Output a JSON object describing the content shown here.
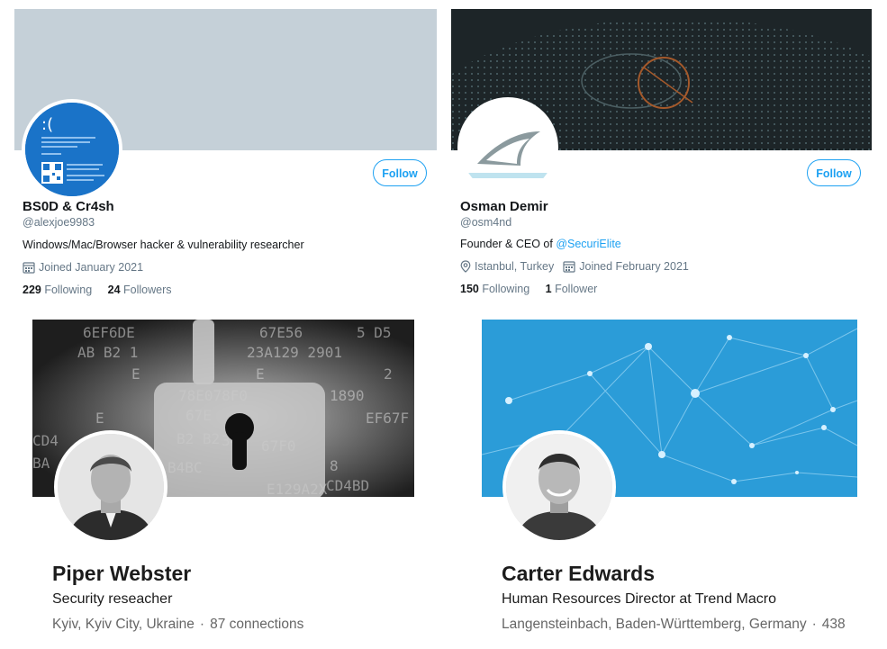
{
  "twitter_cards": [
    {
      "name": "BS0D & Cr4sh",
      "handle": "@alexjoe9983",
      "bio": "Windows/Mac/Browser hacker & vulnerability researcher",
      "joined": "Joined January 2021",
      "following_count": "229",
      "following_label": "Following",
      "followers_count": "24",
      "followers_label": "Followers",
      "follow_label": "Follow"
    },
    {
      "name": "Osman Demir",
      "handle": "@osm4nd",
      "bio_prefix": "Founder & CEO of ",
      "bio_link": "@SecuriElite",
      "location": "Istanbul, Turkey",
      "joined": "Joined February 2021",
      "following_count": "150",
      "following_label": "Following",
      "followers_count": "1",
      "followers_label": "Follower",
      "follow_label": "Follow"
    }
  ],
  "linkedin_cards": [
    {
      "name": "Piper Webster",
      "headline": "Security reseacher",
      "location": "Kyiv, Kyiv City, Ukraine",
      "separator": "·",
      "connections": "87 connections"
    },
    {
      "name": "Carter Edwards",
      "headline": "Human Resources Director at Trend Macro",
      "location": "Langensteinbach, Baden-Württemberg, Germany",
      "separator": "·",
      "connections": "438"
    }
  ],
  "colors": {
    "twitter_blue": "#1da1f2",
    "muted_text": "#657786",
    "bsod_blue": "#1a73c8",
    "linkedin_banner_blue": "#2b9cd8"
  },
  "icons": [
    "calendar-icon",
    "location-pin-icon",
    "qr-code-icon",
    "shark-fin-logo-icon",
    "padlock-icon"
  ]
}
